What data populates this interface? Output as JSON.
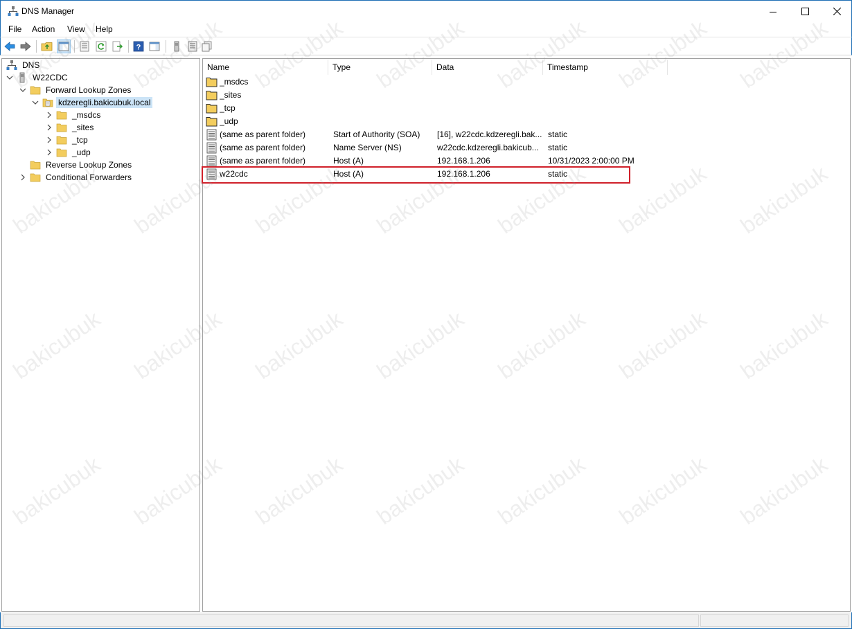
{
  "window": {
    "title": "DNS Manager"
  },
  "menu": [
    "File",
    "Action",
    "View",
    "Help"
  ],
  "tree": {
    "root": "DNS",
    "server": "W22CDC",
    "forward_zones": "Forward Lookup Zones",
    "zone": "kdzeregli.bakicubuk.local",
    "zone_children": [
      "_msdcs",
      "_sites",
      "_tcp",
      "_udp"
    ],
    "reverse_zones": "Reverse Lookup Zones",
    "conditional_forwarders": "Conditional Forwarders"
  },
  "list": {
    "columns": [
      "Name",
      "Type",
      "Data",
      "Timestamp"
    ],
    "rows": [
      {
        "icon": "folder-icon",
        "name": "_msdcs",
        "type": "",
        "data": "",
        "timestamp": ""
      },
      {
        "icon": "folder-icon",
        "name": "_sites",
        "type": "",
        "data": "",
        "timestamp": ""
      },
      {
        "icon": "folder-icon",
        "name": "_tcp",
        "type": "",
        "data": "",
        "timestamp": ""
      },
      {
        "icon": "folder-icon",
        "name": "_udp",
        "type": "",
        "data": "",
        "timestamp": ""
      },
      {
        "icon": "record-icon",
        "name": "(same as parent folder)",
        "type": "Start of Authority (SOA)",
        "data": "[16], w22cdc.kdzeregli.bak...",
        "timestamp": "static"
      },
      {
        "icon": "record-icon",
        "name": "(same as parent folder)",
        "type": "Name Server (NS)",
        "data": "w22cdc.kdzeregli.bakicub...",
        "timestamp": "static"
      },
      {
        "icon": "record-icon",
        "name": "(same as parent folder)",
        "type": "Host (A)",
        "data": "192.168.1.206",
        "timestamp": "10/31/2023 2:00:00 PM"
      },
      {
        "icon": "record-icon",
        "name": "w22cdc",
        "type": "Host (A)",
        "data": "192.168.1.206",
        "timestamp": "static"
      }
    ]
  },
  "watermark": "bakicubuk",
  "colors": {
    "accent": "#1e6fb5",
    "selection": "#cce4f7",
    "highlight_border": "#d0202a",
    "folder": "#f3cd5e"
  }
}
